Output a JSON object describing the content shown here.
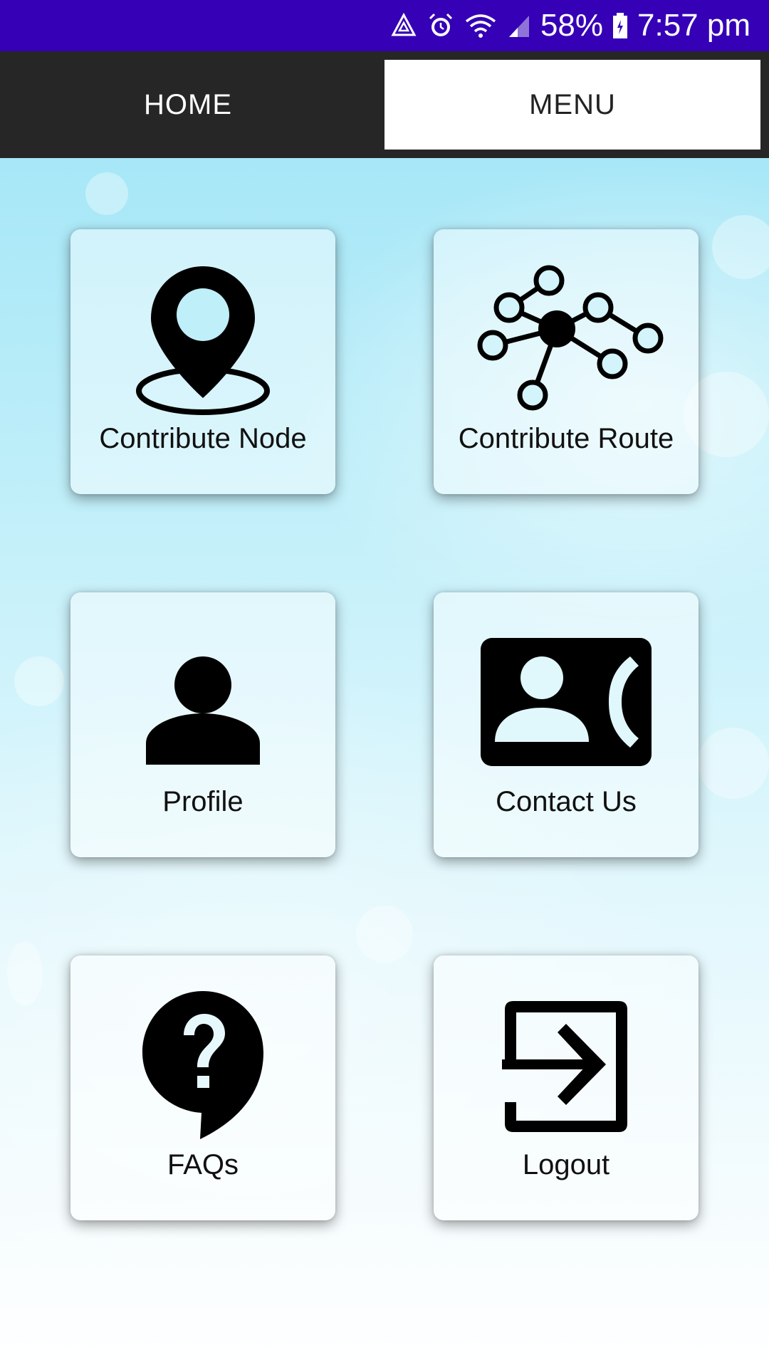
{
  "status_bar": {
    "battery": "58%",
    "time": "7:57 pm",
    "icons": [
      "recycle-alert-icon",
      "alarm-icon",
      "wifi-icon",
      "signal-icon",
      "battery-icon"
    ]
  },
  "tabs": [
    {
      "label": "HOME",
      "selected": false
    },
    {
      "label": "MENU",
      "selected": true
    }
  ],
  "menu": {
    "items": [
      {
        "label": "Contribute Node",
        "icon": "map-pin-icon"
      },
      {
        "label": "Contribute Route",
        "icon": "network-graph-icon"
      },
      {
        "label": "Profile",
        "icon": "person-icon"
      },
      {
        "label": "Contact Us",
        "icon": "contact-card-phone-icon"
      },
      {
        "label": "FAQs",
        "icon": "help-bubble-icon"
      },
      {
        "label": "Logout",
        "icon": "logout-arrow-icon"
      }
    ]
  },
  "colors": {
    "status_bar": "#3500b6",
    "tab_bar": "#262626",
    "selected_tab": "#ffffff"
  }
}
